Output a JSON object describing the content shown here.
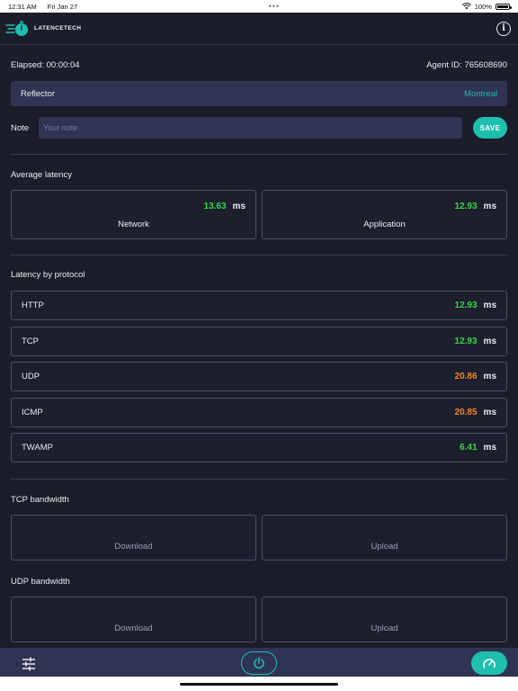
{
  "status": {
    "time": "12:31 AM",
    "date": "Fri Jan 27",
    "dots": "•••",
    "battery": "100%",
    "icons": [
      "wifi-icon",
      "battery-icon"
    ]
  },
  "header": {
    "brand": "LATENCETECH",
    "icons": [
      "latencetech-logo",
      "info-icon"
    ]
  },
  "meta": {
    "elapsed": "Elapsed: 00:00:04",
    "agent": "Agent ID: 765608690"
  },
  "reflector": {
    "label": "Reflector",
    "value": "Montreal"
  },
  "note": {
    "label": "Note",
    "placeholder": "Your note",
    "save": "SAVE"
  },
  "average": {
    "title": "Average latency",
    "cards": [
      {
        "value": "13.63",
        "unit": "ms",
        "label": "Network"
      },
      {
        "value": "12.93",
        "unit": "ms",
        "label": "Application"
      }
    ]
  },
  "protocols": {
    "title": "Latency by protocol",
    "rows": [
      {
        "name": "HTTP",
        "value": "12.93",
        "unit": "ms",
        "status": "green"
      },
      {
        "name": "TCP",
        "value": "12.93",
        "unit": "ms",
        "status": "green"
      },
      {
        "name": "UDP",
        "value": "20.86",
        "unit": "ms",
        "status": "orange"
      },
      {
        "name": "ICMP",
        "value": "20.85",
        "unit": "ms",
        "status": "orange"
      },
      {
        "name": "TWAMP",
        "value": "6.41",
        "unit": "ms",
        "status": "green"
      }
    ]
  },
  "tcp_bandwidth": {
    "title": "TCP bandwidth",
    "download": "Download",
    "upload": "Upload"
  },
  "udp_bandwidth": {
    "title": "UDP bandwidth",
    "download": "Download",
    "upload": "Upload"
  },
  "bottom_bar": {
    "icons": [
      "settings-sliders-icon",
      "power-icon",
      "speedometer-icon"
    ]
  },
  "colors": {
    "accent": "#1ebfae",
    "good": "#35d63f",
    "warn": "#f28324",
    "background": "#1b1d2b",
    "panel": "#2f3452"
  }
}
